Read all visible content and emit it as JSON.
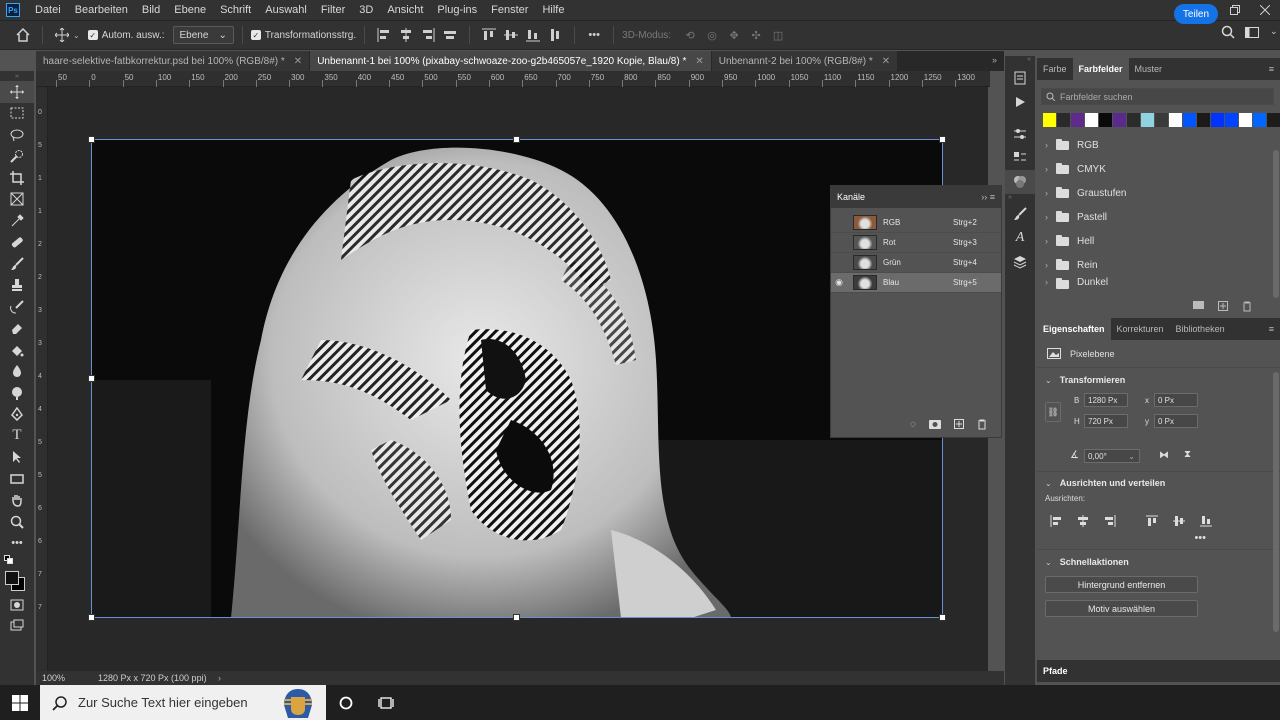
{
  "menubar": {
    "logo": "Ps",
    "items": [
      "Datei",
      "Bearbeiten",
      "Bild",
      "Ebene",
      "Schrift",
      "Auswahl",
      "Filter",
      "3D",
      "Ansicht",
      "Plug-ins",
      "Fenster",
      "Hilfe"
    ]
  },
  "options": {
    "auto_select_label": "Autom. ausw.:",
    "layer_dropdown": "Ebene",
    "transform_label": "Transformationsstrg.",
    "mode_3d": "3D-Modus:",
    "share": "Teilen"
  },
  "tabs": [
    {
      "label": "haare-selektive-fatbkorrektur.psd bei 100% (RGB/8#) *",
      "active": false
    },
    {
      "label": "Unbenannt-1 bei 100% (pixabay-schwoaze-zoo-g2b465057e_1920 Kopie, Blau/8) *",
      "active": true
    },
    {
      "label": "Unbenannt-2 bei 100% (RGB/8#) *",
      "active": false
    }
  ],
  "ruler_h": [
    "50",
    "0",
    "50",
    "100",
    "150",
    "200",
    "250",
    "300",
    "350",
    "400",
    "450",
    "500",
    "550",
    "600",
    "650",
    "700",
    "750",
    "800",
    "850",
    "900",
    "950",
    "1000",
    "1050",
    "1100",
    "1150",
    "1200",
    "1250",
    "1300"
  ],
  "ruler_v": [
    "0",
    "5",
    "1",
    "1",
    "2",
    "2",
    "3",
    "3",
    "4",
    "4",
    "5",
    "5",
    "6",
    "6",
    "7",
    "7"
  ],
  "status": {
    "zoom": "100%",
    "doc_info": "1280 Px x 720 Px (100 ppi)"
  },
  "channels": {
    "title": "Kanäle",
    "rows": [
      {
        "name": "RGB",
        "shortcut": "Strg+2",
        "visible": false,
        "selected": false,
        "thumb": "#8a5a3a"
      },
      {
        "name": "Rot",
        "shortcut": "Strg+3",
        "visible": false,
        "selected": false,
        "thumb": "#555555"
      },
      {
        "name": "Grün",
        "shortcut": "Strg+4",
        "visible": false,
        "selected": false,
        "thumb": "#4a4a4a"
      },
      {
        "name": "Blau",
        "shortcut": "Strg+5",
        "visible": true,
        "selected": true,
        "thumb": "#3c3c3c"
      }
    ]
  },
  "swatches_panel": {
    "tabs": [
      "Farbe",
      "Farbfelder",
      "Muster"
    ],
    "active_tab": "Farbfelder",
    "search_placeholder": "Farbfelder suchen",
    "colors": [
      "#ffff00",
      "#2a2a2a",
      "#5e2a8c",
      "#ffffff",
      "#0a0a0a",
      "#5a2a8c",
      "#2b2b2b",
      "#8fd3e0",
      "#3a3a3a",
      "#ffffff",
      "#0055ff",
      "#1a1a1a",
      "#0033ff",
      "#0044ff",
      "#ffffff",
      "#0066ff",
      "#1c1c1c"
    ],
    "groups": [
      "RGB",
      "CMYK",
      "Graustufen",
      "Pastell",
      "Hell",
      "Rein",
      "Dunkel"
    ]
  },
  "properties_panel": {
    "tabs": [
      "Eigenschaften",
      "Korrekturen",
      "Bibliotheken"
    ],
    "active_tab": "Eigenschaften",
    "layer_type": "Pixelebene",
    "transform_title": "Transformieren",
    "w_label": "B",
    "w_value": "1280 Px",
    "x_label": "x",
    "x_value": "0 Px",
    "h_label": "H",
    "h_value": "720 Px",
    "y_label": "y",
    "y_value": "0 Px",
    "angle_value": "0,00°",
    "align_title": "Ausrichten und verteilen",
    "align_label": "Ausrichten:",
    "quick_title": "Schnellaktionen",
    "btn_remove_bg": "Hintergrund entfernen",
    "btn_select_subject": "Motiv auswählen"
  },
  "paths_panel": {
    "title": "Pfade"
  },
  "taskbar": {
    "search_placeholder": "Zur Suche Text hier eingeben"
  }
}
